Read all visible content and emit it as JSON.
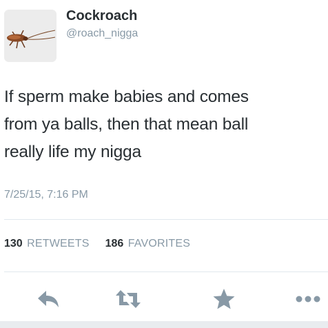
{
  "user": {
    "display_name": "Cockroach",
    "handle": "@roach_nigga",
    "avatar_icon": "cockroach-icon"
  },
  "tweet": {
    "lines": [
      "If sperm make babies and comes",
      "from ya balls, then that mean ball",
      "really life my nigga"
    ],
    "timestamp": "7/25/15, 7:16 PM"
  },
  "stats": {
    "retweets_count": "130",
    "retweets_label": "RETWEETS",
    "favorites_count": "186",
    "favorites_label": "FAVORITES"
  },
  "actions": {
    "reply_icon": "reply-icon",
    "retweet_icon": "retweet-icon",
    "favorite_icon": "star-icon",
    "more_icon": "more-icon"
  },
  "colors": {
    "text": "#292f33",
    "secondary": "#8899a6",
    "action_icon": "#8899a6",
    "divider": "#e1e8ed"
  }
}
